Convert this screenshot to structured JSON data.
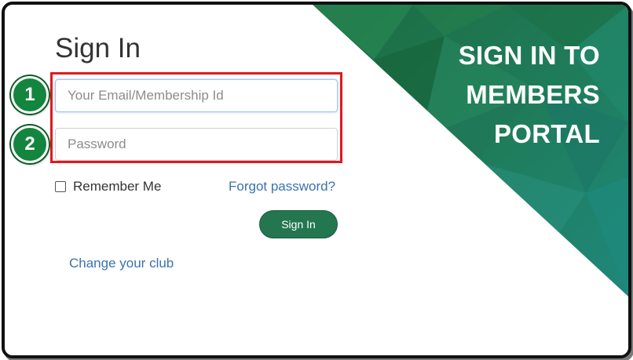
{
  "form": {
    "title": "Sign In",
    "email_placeholder": "Your Email/Membership Id",
    "email_value": "",
    "password_placeholder": "Password",
    "password_value": "",
    "remember_label": "Remember Me",
    "remember_checked": false,
    "forgot_label": "Forgot password?",
    "submit_label": "Sign In",
    "change_club_label": "Change your club"
  },
  "steps": [
    {
      "number": "1"
    },
    {
      "number": "2"
    }
  ],
  "banner": {
    "lines": [
      "SIGN IN TO",
      "MEMBERS",
      "PORTAL"
    ]
  },
  "colors": {
    "accent_green": "#237650",
    "banner_green_dark": "#1d6a44",
    "banner_teal": "#1f8478",
    "link_blue": "#3a72b0",
    "highlight_red": "#e0191e",
    "badge_green": "#14853e"
  }
}
